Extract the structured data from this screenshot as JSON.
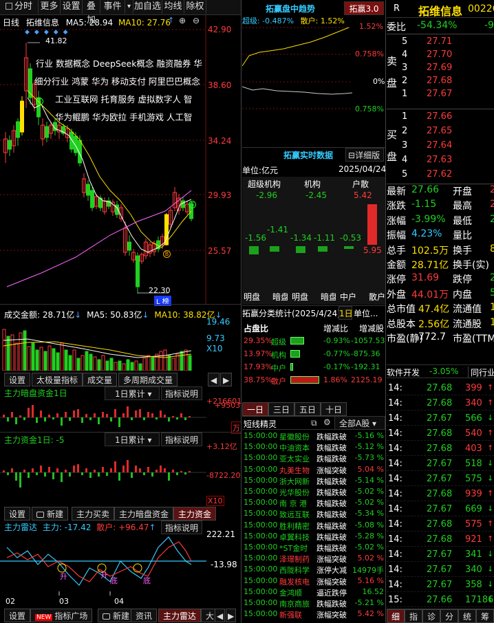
{
  "toolbar": {
    "items": [
      "分时",
      "更多",
      "设置",
      "叠加",
      "事件",
      "加自选",
      "均线",
      "除权"
    ],
    "dropdown": "▾"
  },
  "kline": {
    "period": "日线",
    "name": "拓维信息",
    "ma5_label": "MA5: 28.94",
    "ma10_label": "MA10: 27.76",
    "price_axis": [
      "42.90",
      "38.60",
      "34.24",
      "29.93",
      "25.57"
    ],
    "high_mark": "41.82",
    "low_mark": "22.30",
    "tag_box": "L 榜",
    "concepts": [
      "行业 数据概念 DeepSeek概念 融资融券 华",
      "细分行业 鸿蒙 华为 移动支付 阿里巴巴概念",
      "工业互联网 托育服务 虚拟数字人 智",
      "华为鲲鹏 华为欧拉 手机游戏 人工智"
    ],
    "badge_s": "S",
    "badge_b": "B"
  },
  "volume": {
    "title": "成交金额: 28.71亿",
    "ma5": "MA5: 50.83亿",
    "ma10": "MA10: 38.82亿",
    "axis": [
      "19.46",
      "9.73"
    ],
    "unit": "X10"
  },
  "indicator_tabs1": [
    "设置",
    "太极量指标",
    "成交量",
    "多周期成交量"
  ],
  "dark_fund": {
    "title": "主力暗盘资金1日",
    "select": "1日累计",
    "explain": "指标说明",
    "axis_top": "+216601",
    "axis_mid": "+9503",
    "unit": "万"
  },
  "main_fund": {
    "title": "主力资金1日: -5",
    "select": "1日累计",
    "explain": "指标说明",
    "axis_top": "+3.12亿",
    "axis_mid": "-8722.20",
    "unit": "X10"
  },
  "indicator_tabs2": [
    "设置",
    "新建",
    "主力买卖",
    "主力暗盘资金",
    "主力资金"
  ],
  "radar": {
    "title": "主力雷达",
    "main": "主力: -17.42",
    "retail": "散户: +96.47",
    "explain": "指标说明",
    "axis_top": "222.21",
    "axis_mid": "-13.98",
    "dates": [
      "02",
      "03",
      "04"
    ],
    "markers": [
      "升",
      "升",
      "底",
      "底"
    ]
  },
  "bottom_tabs": [
    "设置",
    "NEW",
    "指标广场",
    "新建",
    "资讯",
    "主力雷达",
    "大"
  ],
  "intraday": {
    "title": "拓赢盘中趋势",
    "tab": "拓赢3.0",
    "super": "超级: -0.487%",
    "retail": "散户: 1.52%",
    "axis": [
      "1.52%",
      "0.758%",
      "0%",
      "0.758%"
    ]
  },
  "realtime": {
    "title": "拓赢实时数据",
    "detail": "详细版",
    "unit": "单位:亿元",
    "date": "2025/04/24",
    "cols": [
      "超级机构",
      "机构",
      "户散"
    ],
    "vals_top": [
      "-2.96",
      "-2.45",
      "5.42"
    ],
    "vals_mid": [
      "-1.41",
      "-1.56",
      "-1.34",
      "-1.11",
      "-0.53"
    ],
    "val_red": "5.95",
    "labels": [
      "明盘",
      "暗盘",
      "明盘",
      "暗盘",
      "中户",
      "散户"
    ]
  },
  "classify": {
    "title": "拓赢分类统计(2025/4/24)",
    "tab": "1日",
    "unit": "单位...",
    "headers": [
      "占盘比",
      "增减比",
      "增减股"
    ],
    "rows": [
      {
        "pct": "29.35%",
        "name": "超级",
        "ratio": "-0.93%",
        "shares": "-1057.53"
      },
      {
        "pct": "13.97%",
        "name": "机构",
        "ratio": "-0.77%",
        "shares": "-875.36"
      },
      {
        "pct": "17.93%",
        "name": "中户",
        "ratio": "-0.17%",
        "shares": "-192.31"
      },
      {
        "pct": "38.75%",
        "name": "散户",
        "ratio": "1.86%",
        "shares": "2125.19"
      }
    ]
  },
  "day_tabs": [
    "一日",
    "三日",
    "五日",
    "十日"
  ],
  "sprites": {
    "title": "短线精灵",
    "filter": "全部A股",
    "rows": [
      {
        "t": "15:00:00",
        "n": "星徽股份",
        "e": "跌幅跌破",
        "v": "-5.16 %",
        "c": "green"
      },
      {
        "t": "15:00:00",
        "n": "中油资本",
        "e": "跌幅跌破",
        "v": "-5.12 %",
        "c": "green"
      },
      {
        "t": "15:00:00",
        "n": "亚太实业",
        "e": "跌幅跌破",
        "v": "-5.73 %",
        "c": "green"
      },
      {
        "t": "15:00:00",
        "n": "丸美生物",
        "e": "涨幅突破",
        "v": "5.04 %",
        "c": "red"
      },
      {
        "t": "15:00:00",
        "n": "浙大网新",
        "e": "跌幅跌破",
        "v": "-5.14 %",
        "c": "green"
      },
      {
        "t": "15:00:00",
        "n": "光华股份",
        "e": "跌幅跌破",
        "v": "-5.02 %",
        "c": "green"
      },
      {
        "t": "15:00:00",
        "n": "南 京 港",
        "e": "跌幅跌破",
        "v": "-5.02 %",
        "c": "green"
      },
      {
        "t": "15:00:00",
        "n": "致远互联",
        "e": "跌幅跌破",
        "v": "-5.34 %",
        "c": "green"
      },
      {
        "t": "15:00:00",
        "n": "胜利精密",
        "e": "跌幅跌破",
        "v": "-5.08 %",
        "c": "green"
      },
      {
        "t": "15:00:00",
        "n": "卓翼科技",
        "e": "跌幅跌破",
        "v": "-5.28 %",
        "c": "green"
      },
      {
        "t": "15:00:00",
        "n": "*ST金时",
        "e": "跌幅跌破",
        "v": "-5.02 %",
        "c": "green"
      },
      {
        "t": "15:00:00",
        "n": "泽璟制药",
        "e": "涨幅突破",
        "v": "5.02 %",
        "c": "red"
      },
      {
        "t": "15:00:00",
        "n": "西陇科学",
        "e": "涨停大减",
        "v": "14979手",
        "c": "green"
      },
      {
        "t": "15:00:00",
        "n": "融发核电",
        "e": "涨幅突破",
        "v": "5.16 %",
        "c": "red"
      },
      {
        "t": "15:00:00",
        "n": "金鸿顺",
        "e": "逼近跌停",
        "v": "16.52",
        "c": "green"
      },
      {
        "t": "15:00:00",
        "n": "南京商旅",
        "e": "跌幅跌破",
        "v": "-5.21 %",
        "c": "green"
      },
      {
        "t": "15:00:00",
        "n": "新强联",
        "e": "涨幅突破",
        "v": "5.42 %",
        "c": "red"
      }
    ]
  },
  "quote": {
    "marker": "R",
    "name": "拓维信息",
    "code": "00226",
    "weibi_label": "委比",
    "weibi": "-54.34%",
    "weibi_extra": "-9",
    "sell_label": [
      "卖",
      "盘"
    ],
    "buy_label": [
      "买",
      "盘"
    ],
    "sell": [
      {
        "lvl": "5",
        "p": "27.71"
      },
      {
        "lvl": "4",
        "p": "27.70"
      },
      {
        "lvl": "3",
        "p": "27.69"
      },
      {
        "lvl": "2",
        "p": "27.68"
      },
      {
        "lvl": "1",
        "p": "27.67"
      }
    ],
    "buy": [
      {
        "lvl": "1",
        "p": "27.66"
      },
      {
        "lvl": "2",
        "p": "27.65"
      },
      {
        "lvl": "3",
        "p": "27.64"
      },
      {
        "lvl": "4",
        "p": "27.63"
      },
      {
        "lvl": "5",
        "p": "27.62"
      }
    ],
    "stats": [
      {
        "a": "最新",
        "av": "27.66",
        "ac": "green",
        "b": "开盘",
        "bv": "2",
        "bc": "red"
      },
      {
        "a": "涨跌",
        "av": "-1.15",
        "ac": "green",
        "b": "最高",
        "bv": "2",
        "bc": "red"
      },
      {
        "a": "涨幅",
        "av": "-3.99%",
        "ac": "green",
        "b": "最低",
        "bv": "2",
        "bc": "green"
      },
      {
        "a": "振幅",
        "av": "4.23%",
        "ac": "cyan",
        "b": "量比",
        "bv": "",
        "bc": "white"
      },
      {
        "a": "总手",
        "av": "102.5万",
        "ac": "yellow",
        "b": "换手",
        "bv": "8",
        "bc": "yellow"
      },
      {
        "a": "金额",
        "av": "28.71亿",
        "ac": "yellow",
        "b": "换手(实)",
        "bv": "",
        "bc": "yellow"
      },
      {
        "a": "涨停",
        "av": "31.69",
        "ac": "red",
        "b": "跌停",
        "bv": "2",
        "bc": "green"
      },
      {
        "a": "外盘",
        "av": "44.01万",
        "ac": "red",
        "b": "内盘",
        "bv": "58.",
        "bc": "green"
      },
      {
        "a": "总市值",
        "av": "47.4亿",
        "ac": "yellow",
        "b": "流通值",
        "bv": "15",
        "bc": "yellow"
      },
      {
        "a": "总股本",
        "av": "2.56亿",
        "ac": "yellow",
        "b": "流通股",
        "bv": "1.",
        "bc": "yellow"
      },
      {
        "a": "市盈(静)",
        "av": "772.7",
        "ac": "white",
        "b": "市盈(TTM)",
        "bv": "",
        "bc": "white"
      }
    ],
    "sector": "软件开发",
    "sector_pct": "-3.05%",
    "peer": "同行业",
    "ticks": [
      {
        "t": "14:",
        "p": "27.68",
        "v": "399",
        "c": "red"
      },
      {
        "t": "14:",
        "p": "27.68",
        "v": "340",
        "c": "red"
      },
      {
        "t": "14:",
        "p": "27.67",
        "v": "566",
        "c": "green"
      },
      {
        "t": "14:",
        "p": "27.68",
        "v": "540",
        "c": "red"
      },
      {
        "t": "14:",
        "p": "27.68",
        "v": "403",
        "c": "red"
      },
      {
        "t": "14:",
        "p": "27.67",
        "v": "518",
        "c": "green"
      },
      {
        "t": "14:",
        "p": "27.67",
        "v": "575",
        "c": "green"
      },
      {
        "t": "14:",
        "p": "27.68",
        "v": "939",
        "c": "red"
      },
      {
        "t": "14:",
        "p": "27.67",
        "v": "669",
        "c": "green"
      },
      {
        "t": "14:",
        "p": "27.68",
        "v": "575",
        "c": "red"
      },
      {
        "t": "14:",
        "p": "27.68",
        "v": "921",
        "c": "red"
      },
      {
        "t": "14:",
        "p": "27.67",
        "v": "341",
        "c": "green"
      },
      {
        "t": "14:",
        "p": "27.67",
        "v": "340",
        "c": "green"
      },
      {
        "t": "14:",
        "p": "27.67",
        "v": "358",
        "c": "green"
      },
      {
        "t": "15:",
        "p": "27.66",
        "v": "17186",
        "c": "green"
      }
    ],
    "bottom_tabs": [
      "细",
      "指",
      "诊",
      "分",
      "统",
      "筹"
    ]
  }
}
